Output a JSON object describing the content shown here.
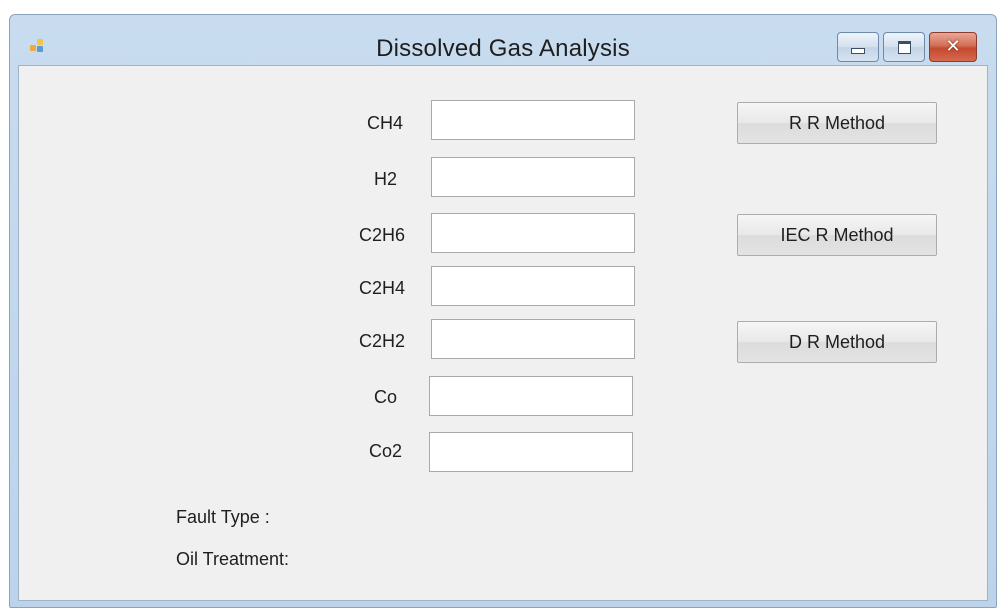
{
  "window": {
    "title": "Dissolved Gas Analysis",
    "app_icon": "form-app-icon",
    "controls": {
      "minimize_icon": "minimize-icon",
      "maximize_icon": "maximize-icon",
      "close_icon": "close-icon",
      "close_glyph": "✕"
    }
  },
  "form": {
    "fields": [
      {
        "label": "CH4",
        "value": ""
      },
      {
        "label": "H2",
        "value": ""
      },
      {
        "label": "C2H6",
        "value": ""
      },
      {
        "label": "C2H4",
        "value": ""
      },
      {
        "label": "C2H2",
        "value": ""
      },
      {
        "label": "Co",
        "value": ""
      },
      {
        "label": "Co2",
        "value": ""
      }
    ],
    "buttons": {
      "rr_method": "R R Method",
      "iec_r_method": "IEC R Method",
      "dr_method": "D R Method"
    },
    "results": {
      "fault_type_label": "Fault Type :",
      "oil_treatment_label": "Oil Treatment:"
    }
  },
  "colors": {
    "frame": "#c9dcef",
    "client_background": "#f0f0f0",
    "close_button": "#c44a2f"
  }
}
